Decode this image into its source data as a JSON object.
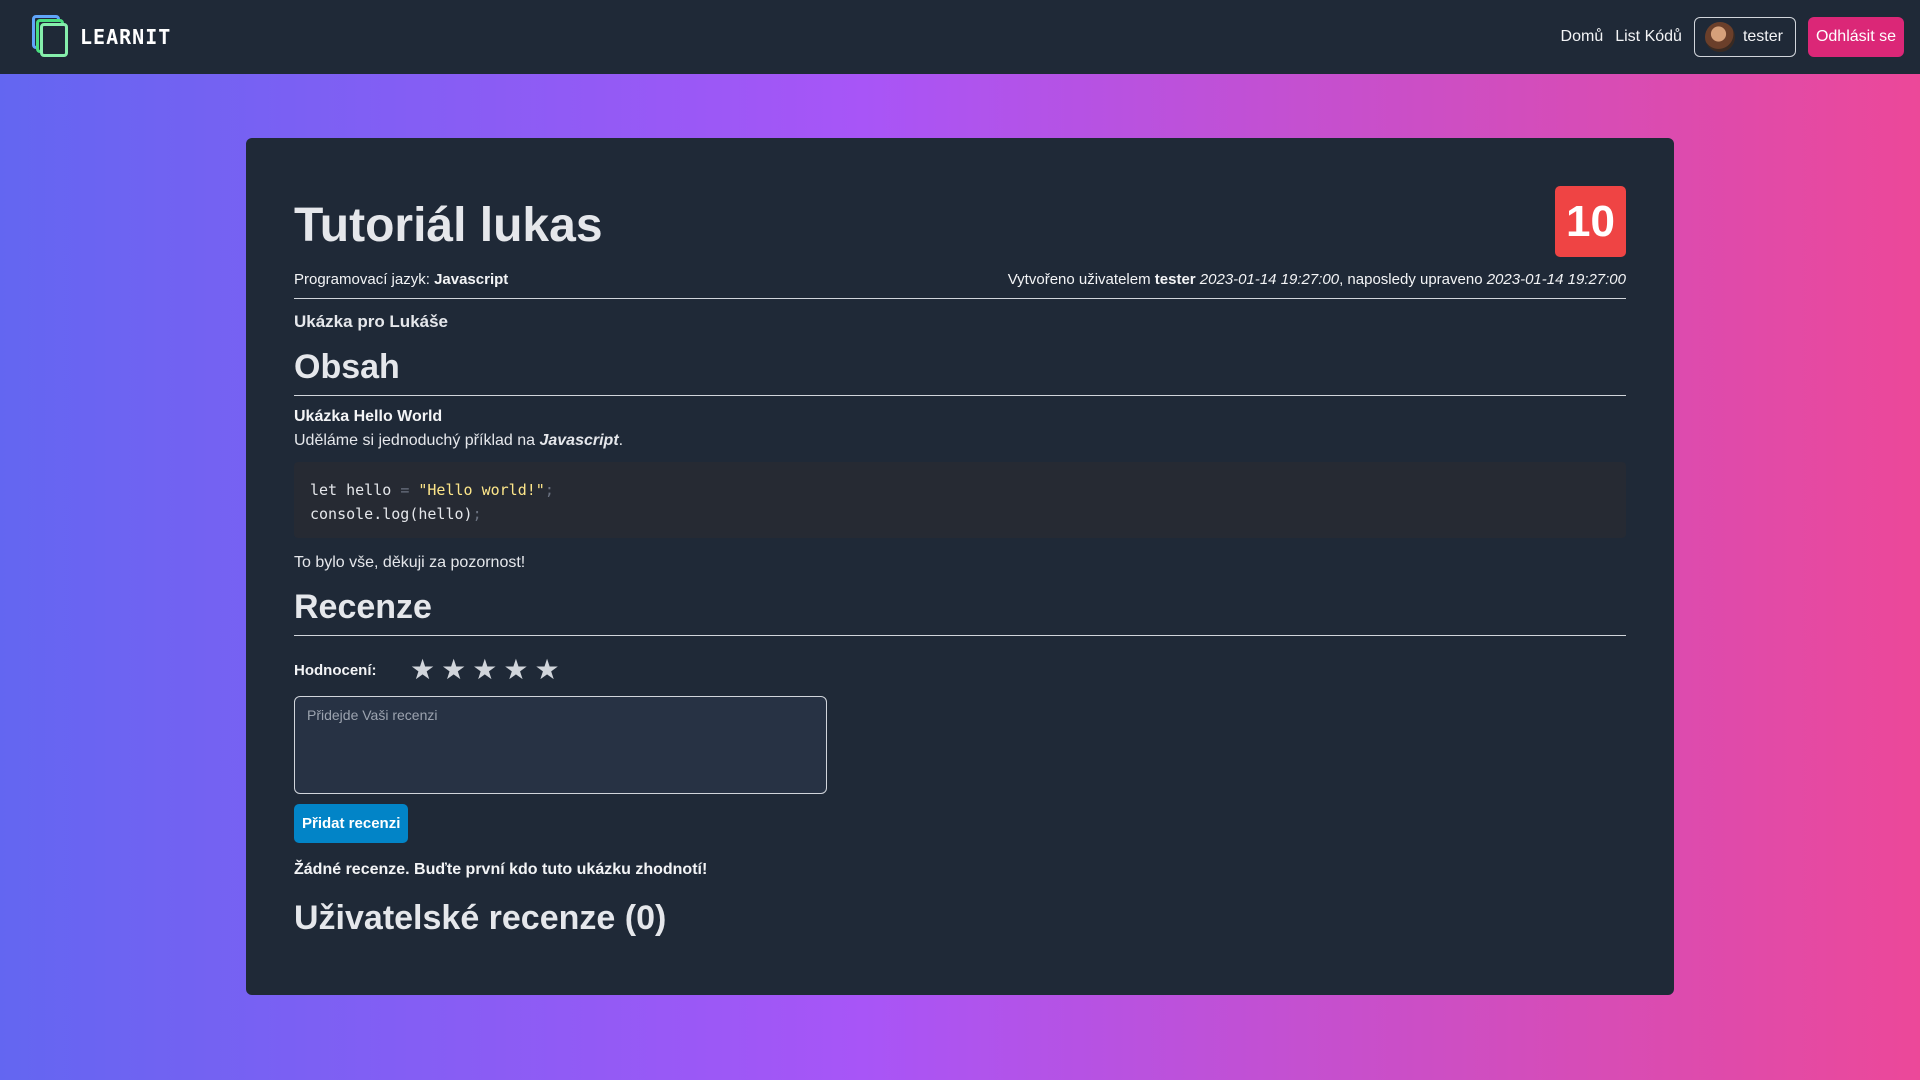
{
  "brand": {
    "name": "LEARNIT"
  },
  "nav": {
    "home": "Domů",
    "code_list": "List Kódů",
    "username": "tester",
    "logout": "Odhlásit se"
  },
  "post": {
    "title": "Tutoriál lukas",
    "score": "10",
    "language_label": "Programovací jazyk:",
    "language": "Javascript",
    "created_by_label": "Vytvořeno uživatelem",
    "author": "tester",
    "created_at": "2023-01-14 19:27:00",
    "updated_label": ", naposledy upraveno",
    "updated_at": "2023-01-14 19:27:00",
    "description": "Ukázka pro Lukáše"
  },
  "content": {
    "heading": "Obsah",
    "subtitle": "Ukázka Hello World",
    "intro_prefix": "Uděláme si jednoduchý příklad na",
    "intro_lang": "Javascript",
    "intro_suffix": ".",
    "code_line1_a": "let hello ",
    "code_line1_op": "=",
    "code_line1_str": "\"Hello world!\"",
    "code_line1_end": ";",
    "code_line2_a": "console.log(hello)",
    "code_line2_end": ";",
    "outro": "To bylo vše, děkuji za pozornost!"
  },
  "reviews": {
    "heading": "Recenze",
    "rating_label": "Hodnocení:",
    "stars": [
      "★",
      "★",
      "★",
      "★",
      "★"
    ],
    "placeholder": "Přidejde Vaši recenzi",
    "submit": "Přidat recenzi",
    "empty_text": "Žádné recenze. Buďte první kdo tuto ukázku zhodnotí!",
    "user_reviews_heading": "Uživatelské recenze (0)"
  },
  "colors": {
    "accent_badge": "#ef4444",
    "logout": "#db2777",
    "submit": "#0284c7"
  }
}
